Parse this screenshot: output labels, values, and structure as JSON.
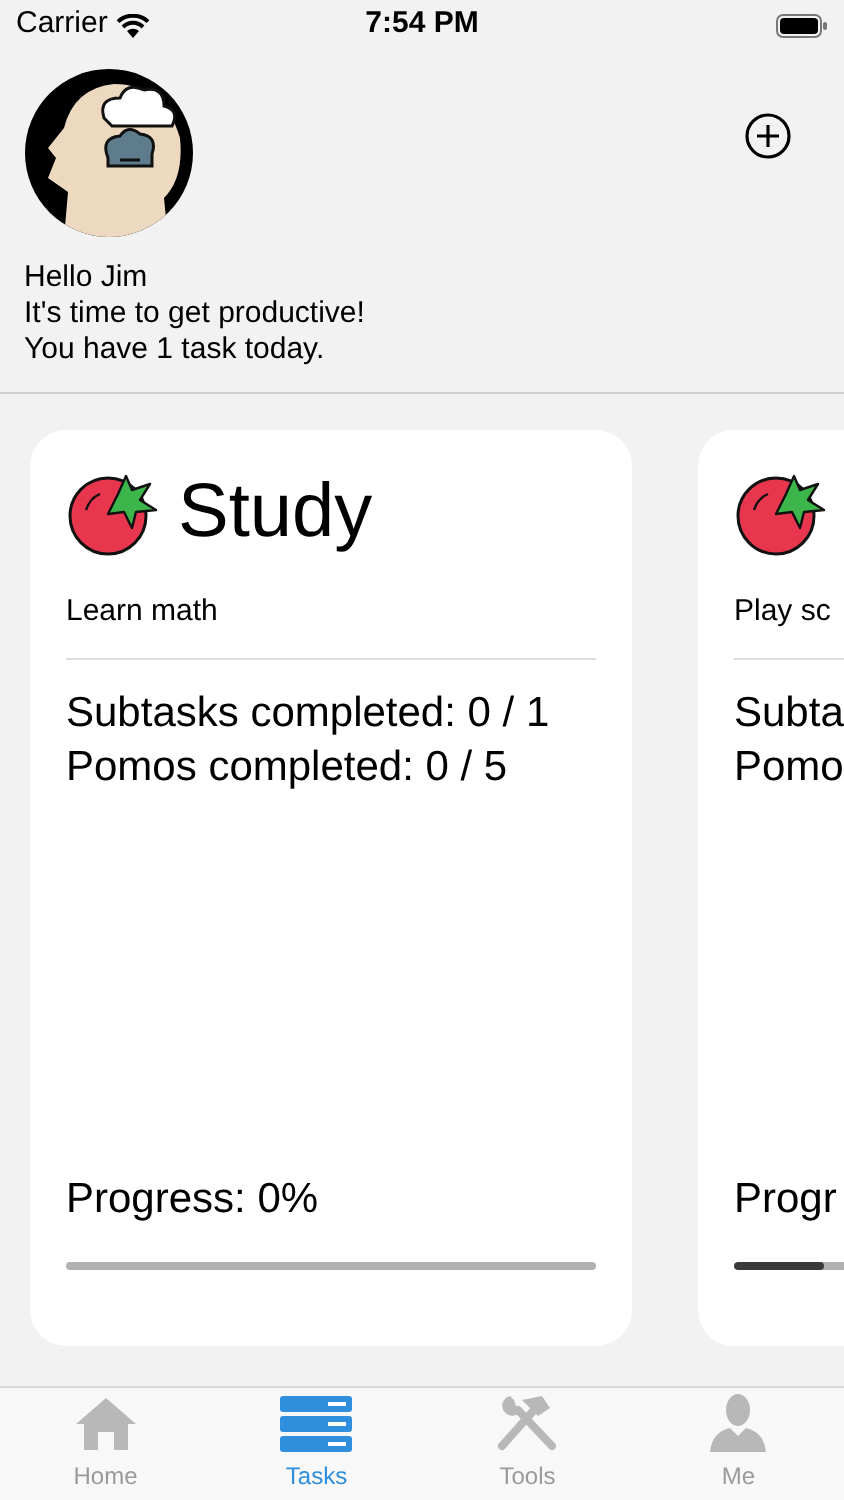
{
  "status_bar": {
    "carrier": "Carrier",
    "time": "7:54 PM"
  },
  "greeting": {
    "lines": [
      "Hello Jim",
      "It's time to get productive!",
      "You have 1 task today."
    ]
  },
  "cards": [
    {
      "title": "Study",
      "description": "Learn math",
      "stats": [
        "Subtasks completed: 0 / 1",
        "Pomos completed: 0 / 5"
      ],
      "progress_label": "Progress: 0%",
      "level": 0
    },
    {
      "description": "Play sc",
      "stats": [
        "Subta",
        "Pomo"
      ],
      "progress_label": "Progr",
      "level": 0.17
    }
  ],
  "tab_bar": [
    {
      "kind": "home",
      "label": "Home",
      "selected": false
    },
    {
      "kind": "tasks",
      "label": "Tasks",
      "selected": true
    },
    {
      "kind": "tools",
      "label": "Tools",
      "selected": false
    },
    {
      "kind": "me",
      "label": "Me",
      "selected": false
    }
  ]
}
